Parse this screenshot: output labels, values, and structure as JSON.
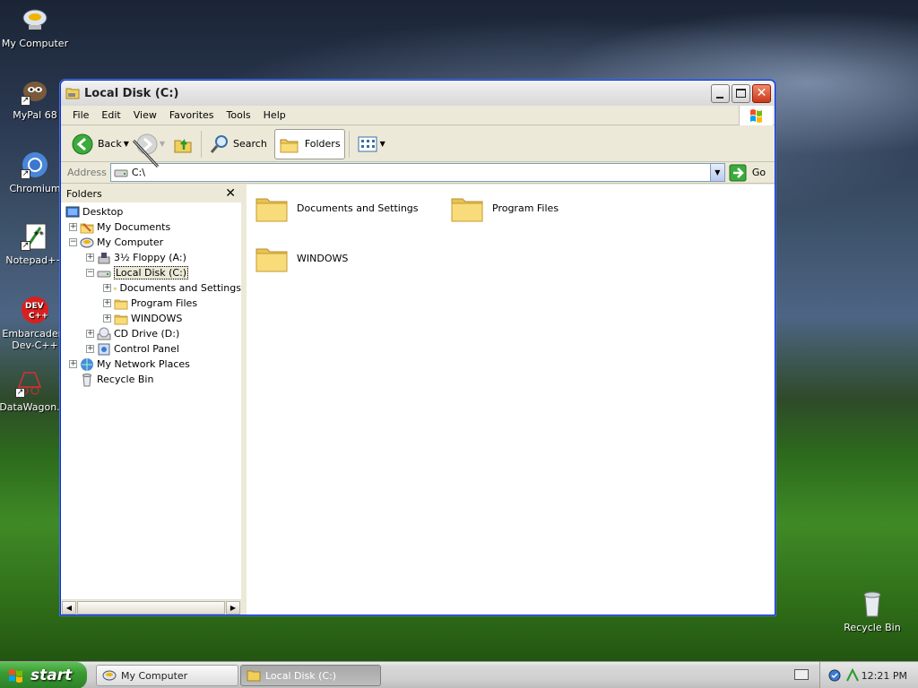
{
  "desktop": {
    "icons": [
      {
        "label": "My Computer",
        "icon": "my-computer-icon"
      },
      {
        "label": "MyPal 68",
        "icon": "mypal-icon"
      },
      {
        "label": "Chromium",
        "icon": "chromium-icon"
      },
      {
        "label": "Notepad++",
        "icon": "notepadpp-icon"
      },
      {
        "label": "Embarcadero Dev-C++",
        "icon": "devcpp-icon"
      },
      {
        "label": "DataWagon.",
        "icon": "datawagon-icon"
      },
      {
        "label": "Recycle Bin",
        "icon": "recycle-bin-icon"
      }
    ]
  },
  "window": {
    "title": "Local Disk (C:)",
    "menu": [
      "File",
      "Edit",
      "View",
      "Favorites",
      "Tools",
      "Help"
    ],
    "toolbar": {
      "back_label": "Back",
      "search_label": "Search",
      "folders_label": "Folders"
    },
    "address": {
      "label": "Address",
      "value": "C:\\",
      "go_label": "Go"
    },
    "folders_pane": {
      "title": "Folders",
      "tree": [
        {
          "label": "Desktop"
        },
        {
          "label": "My Documents"
        },
        {
          "label": "My Computer"
        },
        {
          "label": "3½ Floppy (A:)"
        },
        {
          "label": "Local Disk (C:)"
        },
        {
          "label": "Documents and Settings"
        },
        {
          "label": "Program Files"
        },
        {
          "label": "WINDOWS"
        },
        {
          "label": "CD Drive (D:)"
        },
        {
          "label": "Control Panel"
        },
        {
          "label": "My Network Places"
        },
        {
          "label": "Recycle Bin"
        }
      ]
    },
    "content": {
      "items": [
        {
          "label": "Documents and Settings"
        },
        {
          "label": "Program Files"
        },
        {
          "label": "WINDOWS"
        }
      ]
    }
  },
  "taskbar": {
    "start_label": "start",
    "tasks": [
      {
        "label": "My Computer"
      },
      {
        "label": "Local Disk (C:)"
      }
    ],
    "clock": "12:21 PM"
  },
  "colors": {
    "title_active_border": "#0831d9",
    "start_green": "#3a9b32",
    "folder_yellow": "#f2d36b"
  }
}
